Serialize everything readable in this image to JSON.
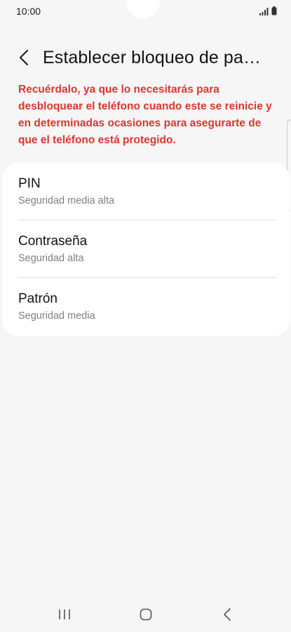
{
  "status_bar": {
    "time": "10:00"
  },
  "header": {
    "title": "Establecer bloqueo de pantalla"
  },
  "warning": {
    "text": "Recuérdalo, ya que lo necesitarás para desbloquear el teléfono cuando este se reinicie y en determinadas ocasiones para asegurarte de que el teléfono está protegido."
  },
  "lock_options": [
    {
      "title": "PIN",
      "subtitle": "Seguridad media alta"
    },
    {
      "title": "Contraseña",
      "subtitle": "Seguridad alta"
    },
    {
      "title": "Patrón",
      "subtitle": "Seguridad media"
    }
  ],
  "colors": {
    "background": "#f6f6f6",
    "warning": "#e0342f",
    "card": "#ffffff"
  },
  "icons": {
    "back": "back-arrow-icon",
    "recents": "recent-apps-icon",
    "home": "home-icon",
    "nav_back": "nav-back-icon"
  }
}
